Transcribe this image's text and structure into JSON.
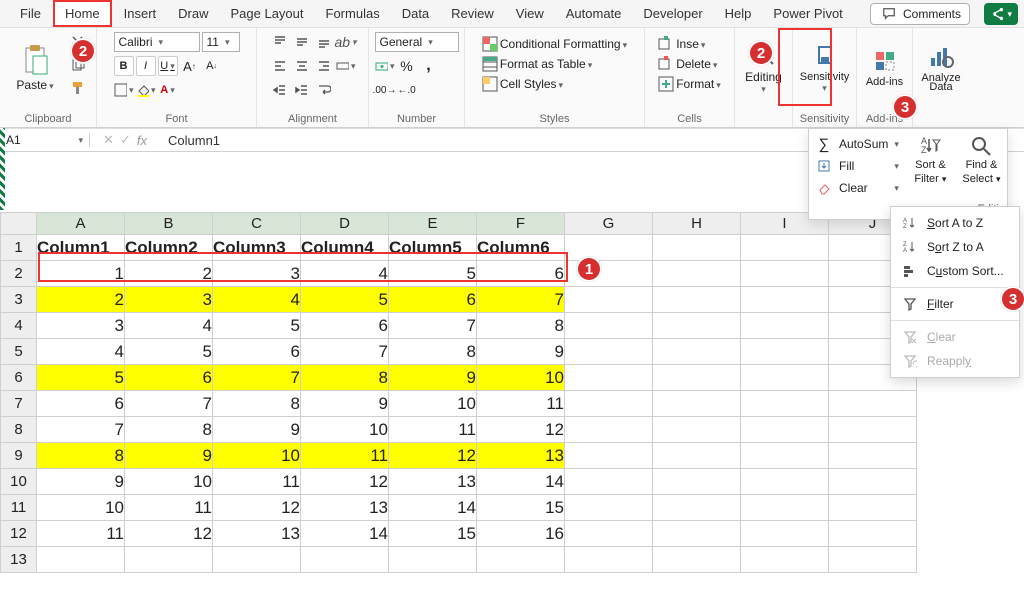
{
  "tabs": [
    "File",
    "Home",
    "Insert",
    "Draw",
    "Page Layout",
    "Formulas",
    "Data",
    "Review",
    "View",
    "Automate",
    "Developer",
    "Help",
    "Power Pivot"
  ],
  "active_tab_index": 1,
  "comments_label": "Comments",
  "ribbon": {
    "clipboard": {
      "paste": "Paste",
      "label": "Clipboard"
    },
    "font": {
      "name": "Calibri",
      "size": "11",
      "b": "B",
      "i": "I",
      "u": "U",
      "label": "Font"
    },
    "alignment": {
      "label": "Alignment"
    },
    "number": {
      "format": "General",
      "label": "Number"
    },
    "styles": {
      "cond_fmt": "Conditional Formatting",
      "as_table": "Format as Table",
      "cell_styles": "Cell Styles",
      "label": "Styles"
    },
    "cells": {
      "insert": "Inse",
      "delete": "Delete",
      "format": "Format",
      "label": "Cells"
    },
    "editing": {
      "label": "Editing"
    },
    "sensitivity": {
      "label": "Sensitivity",
      "v": "Sensitivity"
    },
    "addins": {
      "label": "Add-ins",
      "v": "Add-ins"
    },
    "analyze": {
      "label": "Analyze\nData",
      "v1": "Analyze",
      "v2": "Data"
    }
  },
  "namebox": "A1",
  "formula_bar": "Column1",
  "columns": [
    "A",
    "B",
    "C",
    "D",
    "E",
    "F",
    "G",
    "H",
    "I",
    "J"
  ],
  "row_count": 13,
  "chart_data": {
    "type": "table",
    "headers": [
      "Column1",
      "Column2",
      "Column3",
      "Column4",
      "Column5",
      "Column6"
    ],
    "rows": [
      [
        1,
        2,
        3,
        4,
        5,
        6
      ],
      [
        2,
        3,
        4,
        5,
        6,
        7
      ],
      [
        3,
        4,
        5,
        6,
        7,
        8
      ],
      [
        4,
        5,
        6,
        7,
        8,
        9
      ],
      [
        5,
        6,
        7,
        8,
        9,
        10
      ],
      [
        6,
        7,
        8,
        9,
        10,
        11
      ],
      [
        7,
        8,
        9,
        10,
        11,
        12
      ],
      [
        8,
        9,
        10,
        11,
        12,
        13
      ],
      [
        9,
        10,
        11,
        12,
        13,
        14
      ],
      [
        10,
        11,
        12,
        13,
        14,
        15
      ],
      [
        11,
        12,
        13,
        14,
        15,
        16
      ]
    ],
    "highlighted_rows": [
      1,
      4,
      7
    ]
  },
  "editing_panel": {
    "autosum": "AutoSum",
    "fill": "Fill",
    "clear": "Clear",
    "sort_filter": "Sort &\nFilter",
    "sort_filter1": "Sort &",
    "sort_filter2": "Filter",
    "find_select": "Find &\nSelect",
    "find_select1": "Find &",
    "find_select2": "Select",
    "caption": "Editi"
  },
  "sf_menu": {
    "az": "Sort A to Z",
    "za": "Sort Z to A",
    "custom": "Custom Sort...",
    "filter": "Filter",
    "clear": "Clear",
    "reapply": "Reapply"
  },
  "callouts": {
    "c1": "1",
    "c2": "2",
    "c3": "3"
  },
  "colors": {
    "accent_red": "#d62f2f",
    "excel_green": "#107c41",
    "yellow": "#ffff00"
  }
}
